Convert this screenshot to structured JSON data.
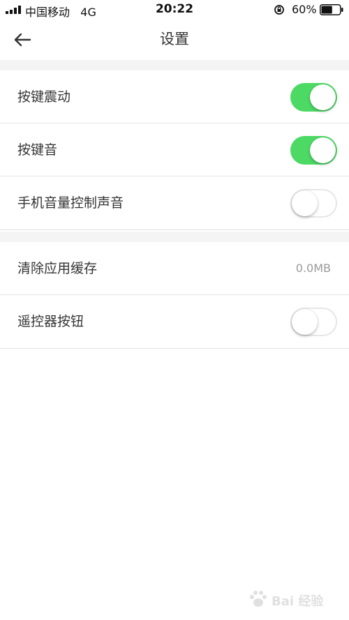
{
  "status_bar": {
    "carrier": "中国移动",
    "network": "4G",
    "time": "20:22",
    "battery": "60%",
    "battery_level": 0.6
  },
  "nav": {
    "title": "设置",
    "back_icon": "arrow-left-icon"
  },
  "sections": [
    {
      "rows": [
        {
          "label": "按键震动",
          "type": "toggle",
          "on": true
        },
        {
          "label": "按键音",
          "type": "toggle",
          "on": true
        },
        {
          "label": "手机音量控制声音",
          "type": "toggle",
          "on": false
        }
      ]
    },
    {
      "rows": [
        {
          "label": "清除应用缓存",
          "type": "value",
          "value": "0.0MB"
        },
        {
          "label": "遥控器按钮",
          "type": "toggle",
          "on": false
        }
      ]
    }
  ],
  "colors": {
    "toggle_on": "#4cd964",
    "background_gap": "#f4f4f4",
    "text": "#333333",
    "secondary_text": "#999999"
  },
  "watermark": {
    "text": "Bai 经验"
  }
}
